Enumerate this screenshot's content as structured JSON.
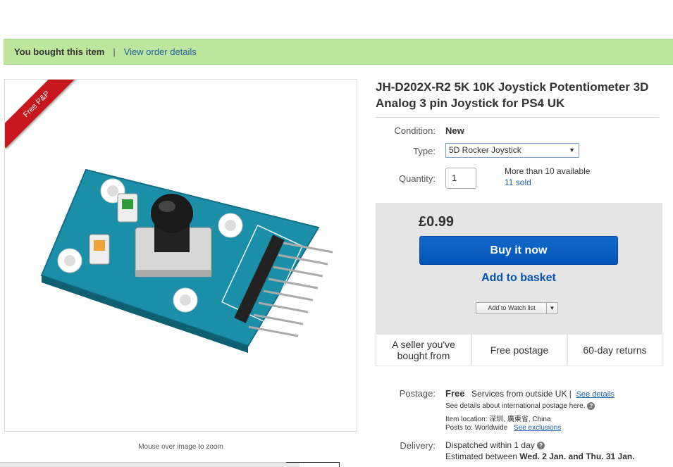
{
  "banner": {
    "bought": "You bought this item",
    "separator": "|",
    "order_link": "View order details"
  },
  "image": {
    "ribbon": "Free P&P",
    "zoom_hint": "Mouse over image to zoom"
  },
  "product": {
    "title": "JH-D202X-R2 5K 10K Joystick Potentiometer 3D Analog 3 pin Joystick for PS4 UK"
  },
  "details": {
    "condition_label": "Condition:",
    "condition_value": "New",
    "type_label": "Type:",
    "type_value": "5D Rocker Joystick",
    "quantity_label": "Quantity:",
    "quantity_value": "1",
    "available": "More than 10 available",
    "sold": "11 sold"
  },
  "buy": {
    "price": "£0.99",
    "buy_now": "Buy it now",
    "add_to_basket": "Add to basket",
    "watch_label": "Add to Watch list",
    "features": [
      "A seller you've bought from",
      "Free postage",
      "60-day returns"
    ]
  },
  "postage": {
    "label": "Postage:",
    "free": "Free",
    "services": "Services from outside UK |",
    "see_details": "See details",
    "intl": "See details about international postage here.",
    "location_label": "Item location:",
    "location": "深圳, 廣東省, China",
    "posts_label": "Posts to:",
    "posts": "Worldwide",
    "exclusions": "See exclusions"
  },
  "delivery": {
    "label": "Delivery:",
    "dispatch": "Dispatched within 1 day",
    "estimated": "Estimated between",
    "dates": "Wed. 2 Jan. and Thu. 31 Jan."
  },
  "colors": {
    "accent": "#0654ba",
    "banner": "#bde59c",
    "ribbon": "#c8161d",
    "board": "#1b8fa8"
  },
  "icons": [
    "question-icon",
    "chevron-down-icon"
  ]
}
